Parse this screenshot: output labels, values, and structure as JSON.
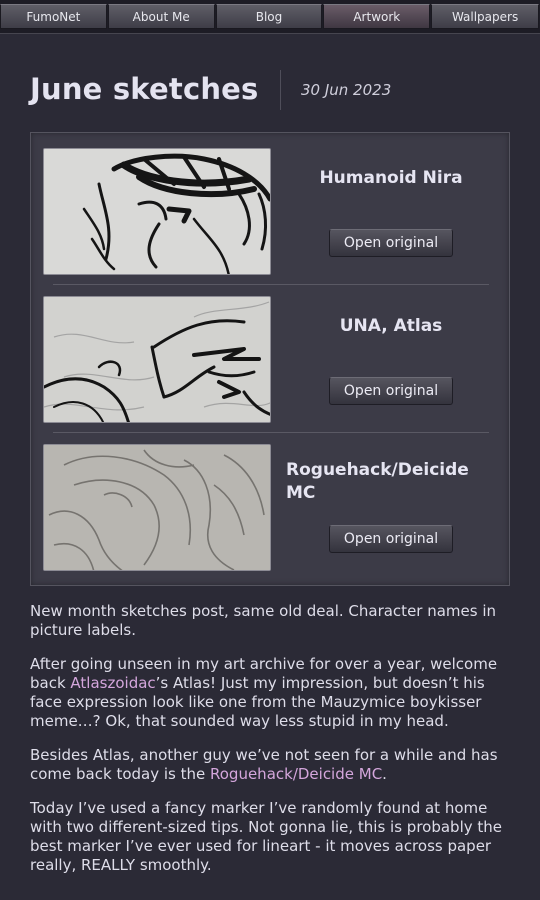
{
  "nav": {
    "items": [
      "FumoNet",
      "About Me",
      "Blog",
      "Artwork",
      "Wallpapers"
    ],
    "active_index": 3
  },
  "header": {
    "title": "June sketches",
    "date": "30 Jun 2023"
  },
  "gallery": {
    "items": [
      {
        "caption": "Humanoid Nira",
        "button_label": "Open original",
        "thumbnail_icon": "sketch-image"
      },
      {
        "caption": "UNA, Atlas",
        "button_label": "Open original",
        "thumbnail_icon": "sketch-image"
      },
      {
        "caption": "Roguehack/Deicide MC",
        "button_label": "Open original",
        "thumbnail_icon": "sketch-image"
      }
    ]
  },
  "article": {
    "p1": "New month sketches post, same old deal. Character names in picture labels.",
    "p2_before": "After going unseen in my art archive for over a year, welcome back ",
    "p2_link": "Atlaszoidac",
    "p2_after": "’s Atlas! Just my impression, but doesn’t his face expression look like one from the Mauzymice boykisser meme…? Ok, that sounded way less stupid in my head.",
    "p3_before": "Besides Atlas, another guy we’ve not seen for a while and has come back today is the ",
    "p3_link": "Roguehack/Deicide MC",
    "p3_after": ".",
    "p4": "Today I’ve used a fancy marker I’ve randomly found at home with two different-sized tips. Not gonna lie, this is probably the best marker I’ve ever used for lineart - it moves across paper really, REALLY smoothly."
  },
  "colors": {
    "background": "#2b2a36",
    "gallery_bg": "#3c3b47",
    "link": "#d4a6dc"
  }
}
